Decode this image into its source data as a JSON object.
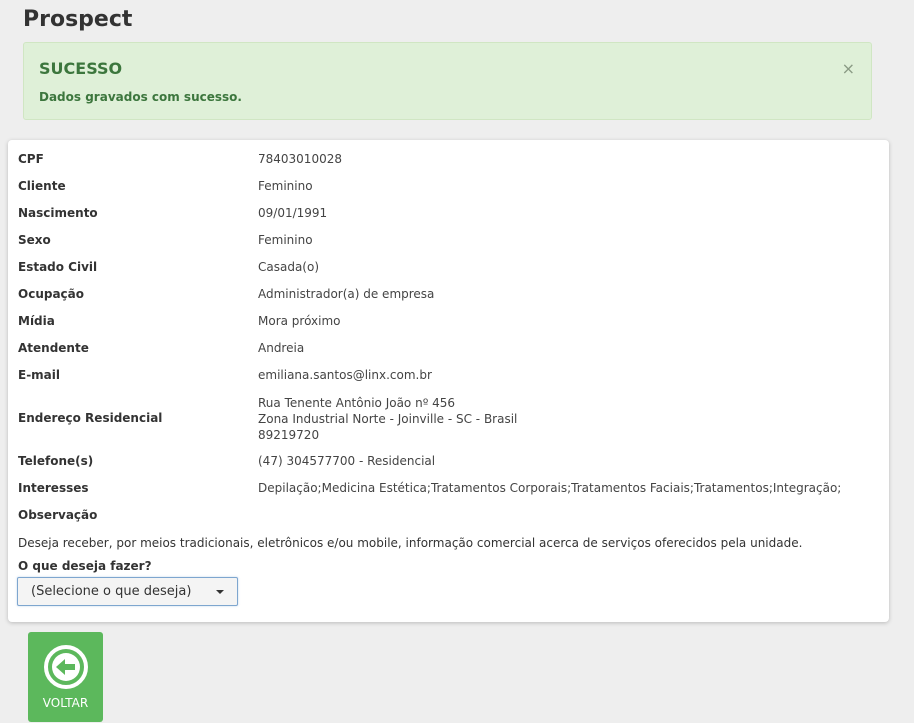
{
  "page": {
    "title": "Prospect"
  },
  "alert": {
    "title": "SUCESSO",
    "message": "Dados gravados com sucesso.",
    "close_symbol": "×"
  },
  "details": [
    {
      "label": "CPF",
      "value": "78403010028"
    },
    {
      "label": "Cliente",
      "value": "Feminino"
    },
    {
      "label": "Nascimento",
      "value": "09/01/1991"
    },
    {
      "label": "Sexo",
      "value": "Feminino"
    },
    {
      "label": "Estado Civil",
      "value": "Casada(o)"
    },
    {
      "label": "Ocupação",
      "value": "Administrador(a) de empresa"
    },
    {
      "label": "Mídia",
      "value": "Mora próximo"
    },
    {
      "label": "Atendente",
      "value": "Andreia"
    },
    {
      "label": "E-mail",
      "value": "emiliana.santos@linx.com.br"
    }
  ],
  "address": {
    "label": "Endereço Residencial",
    "lines": [
      "Rua Tenente Antônio João nº 456",
      "Zona Industrial Norte - Joinville - SC - Brasil",
      "89219720"
    ]
  },
  "phone": {
    "label": "Telefone(s)",
    "value": "(47) 304577700 - Residencial"
  },
  "interests": {
    "label": "Interesses",
    "value": "Depilação;Medicina Estética;Tratamentos Corporais;Tratamentos Faciais;Tratamentos;Integração;"
  },
  "observation": {
    "label": "Observação",
    "text": "Deseja receber, por meios tradicionais, eletrônicos e/ou mobile, informação comercial acerca de serviços oferecidos pela unidade."
  },
  "action": {
    "label": "O que deseja fazer?",
    "selected": "(Selecione o que deseja)"
  },
  "back_button": {
    "label": "VOLTAR",
    "icon": "arrow-left-circle-icon",
    "color": "#5cb85c"
  },
  "colors": {
    "success_bg": "#dff0d8",
    "success_text": "#3c763d",
    "page_bg": "#eeeeee"
  }
}
